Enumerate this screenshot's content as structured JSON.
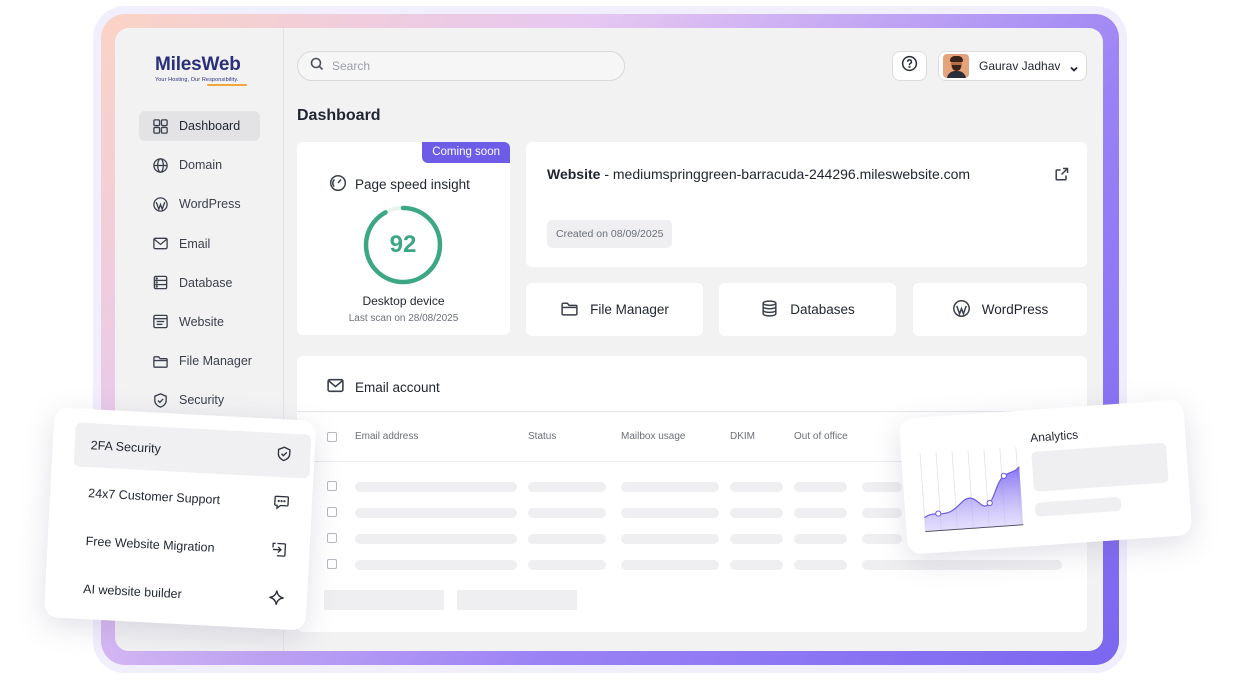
{
  "brand": {
    "name": "MilesWeb",
    "tagline": "Your Hosting, Our Responsibility."
  },
  "sidebar": {
    "items": [
      {
        "label": "Dashboard",
        "icon": "grid-icon"
      },
      {
        "label": "Domain",
        "icon": "globe-icon"
      },
      {
        "label": "WordPress",
        "icon": "wordpress-icon"
      },
      {
        "label": "Email",
        "icon": "mail-icon"
      },
      {
        "label": "Database",
        "icon": "database-icon"
      },
      {
        "label": "Website",
        "icon": "browser-icon"
      },
      {
        "label": "File Manager",
        "icon": "folder-icon"
      },
      {
        "label": "Security",
        "icon": "shield-icon"
      }
    ],
    "active": "Dashboard"
  },
  "header": {
    "search_placeholder": "Search",
    "user_name": "Gaurav Jadhav"
  },
  "page": {
    "title": "Dashboard"
  },
  "speed": {
    "badge": "Coming soon",
    "title": "Page speed insight",
    "score": "92",
    "score_fraction": 0.92,
    "device": "Desktop device",
    "last_scan": "Last scan on 28/08/2025",
    "color": "#3ba882"
  },
  "website": {
    "label": "Website",
    "separator": " - ",
    "domain": "mediumspringgreen-barracuda-244296.mileswebsite.com",
    "created": "Created on 08/09/2025"
  },
  "quick_links": [
    {
      "label": "File Manager",
      "icon": "folder-icon"
    },
    {
      "label": "Databases",
      "icon": "database-icon"
    },
    {
      "label": "WordPress",
      "icon": "wordpress-icon"
    }
  ],
  "email": {
    "title": "Email account",
    "columns": [
      "Email address",
      "Status",
      "Mailbox usage",
      "DKIM",
      "Out of office"
    ]
  },
  "features": [
    {
      "label": "2FA Security",
      "icon": "shield-check-icon"
    },
    {
      "label": "24x7 Customer Support",
      "icon": "chat-icon"
    },
    {
      "label": "Free Website Migration",
      "icon": "migrate-icon"
    },
    {
      "label": "AI website builder",
      "icon": "sparkle-icon"
    }
  ],
  "analytics": {
    "title": "Analytics"
  },
  "colors": {
    "accent": "#6c5ce7",
    "score_green": "#3ba882",
    "brand_navy": "#2a2f7a",
    "brand_orange": "#f3a73a"
  }
}
